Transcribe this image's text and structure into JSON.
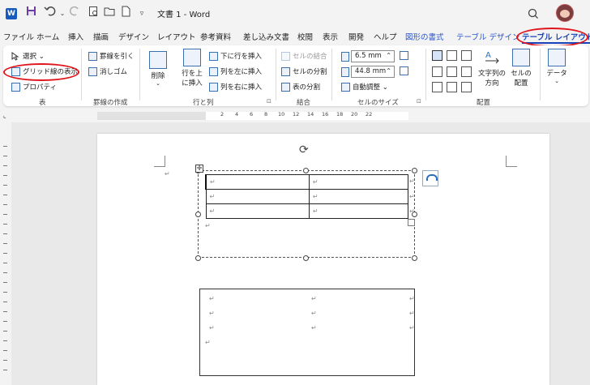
{
  "title_bar": {
    "app_icon": "W",
    "document_title": "文書 1  -  Word",
    "icons": [
      "word-icon",
      "save-icon",
      "undo-icon",
      "redo-icon",
      "print-preview-icon",
      "open-icon",
      "new-icon",
      "customize-icon",
      "search-icon",
      "avatar"
    ]
  },
  "tabs": [
    {
      "label": "ファイル"
    },
    {
      "label": "ホーム"
    },
    {
      "label": "挿入"
    },
    {
      "label": "描画"
    },
    {
      "label": "デザイン"
    },
    {
      "label": "レイアウト"
    },
    {
      "label": "参考資料"
    },
    {
      "label": "差し込み文書"
    },
    {
      "label": "校閲"
    },
    {
      "label": "表示"
    },
    {
      "label": "開発"
    },
    {
      "label": "ヘルプ"
    },
    {
      "label": "図形の書式"
    },
    {
      "label": "テーブル デザイン"
    },
    {
      "label": "テーブル レイアウト"
    }
  ],
  "ribbon": {
    "table_group": {
      "select": "選択 ⌄",
      "gridlines": "グリッド線の表示",
      "properties": "プロパティ",
      "label": "表"
    },
    "draw_group": {
      "draw_table": "罫線を引く",
      "eraser": "消しゴム",
      "label": "罫線の作成"
    },
    "rows_cols_group": {
      "delete": "削除",
      "insert_above_1": "行を上",
      "insert_above_2": "に挿入",
      "insert_below": "下に行を挿入",
      "insert_left": "列を左に挿入",
      "insert_right": "列を右に挿入",
      "label": "行と列"
    },
    "merge_group": {
      "merge_cells": "セルの結合",
      "split_cells": "セルの分割",
      "split_table": "表の分割",
      "label": "結合"
    },
    "cell_size_group": {
      "height": "6.5 mm",
      "width": "44.8 mm",
      "autofit": "自動調整 ⌄",
      "label": "セルのサイズ"
    },
    "alignment_group": {
      "text_direction_1": "文字列の",
      "text_direction_2": "方向",
      "cell_margins_1": "セルの",
      "cell_margins_2": "配置",
      "label": "配置"
    },
    "data_group": {
      "data": "データ",
      "chevron": "⌄"
    },
    "launcher": "⊡"
  },
  "ruler": {
    "numbers": [
      "2",
      "4",
      "6",
      "8",
      "10",
      "12",
      "14",
      "16",
      "18",
      "20",
      "22"
    ]
  },
  "document": {
    "para_mark": "↵",
    "cell_mark": "↵",
    "move_handle": "✛",
    "rotate_handle": "⟳"
  }
}
